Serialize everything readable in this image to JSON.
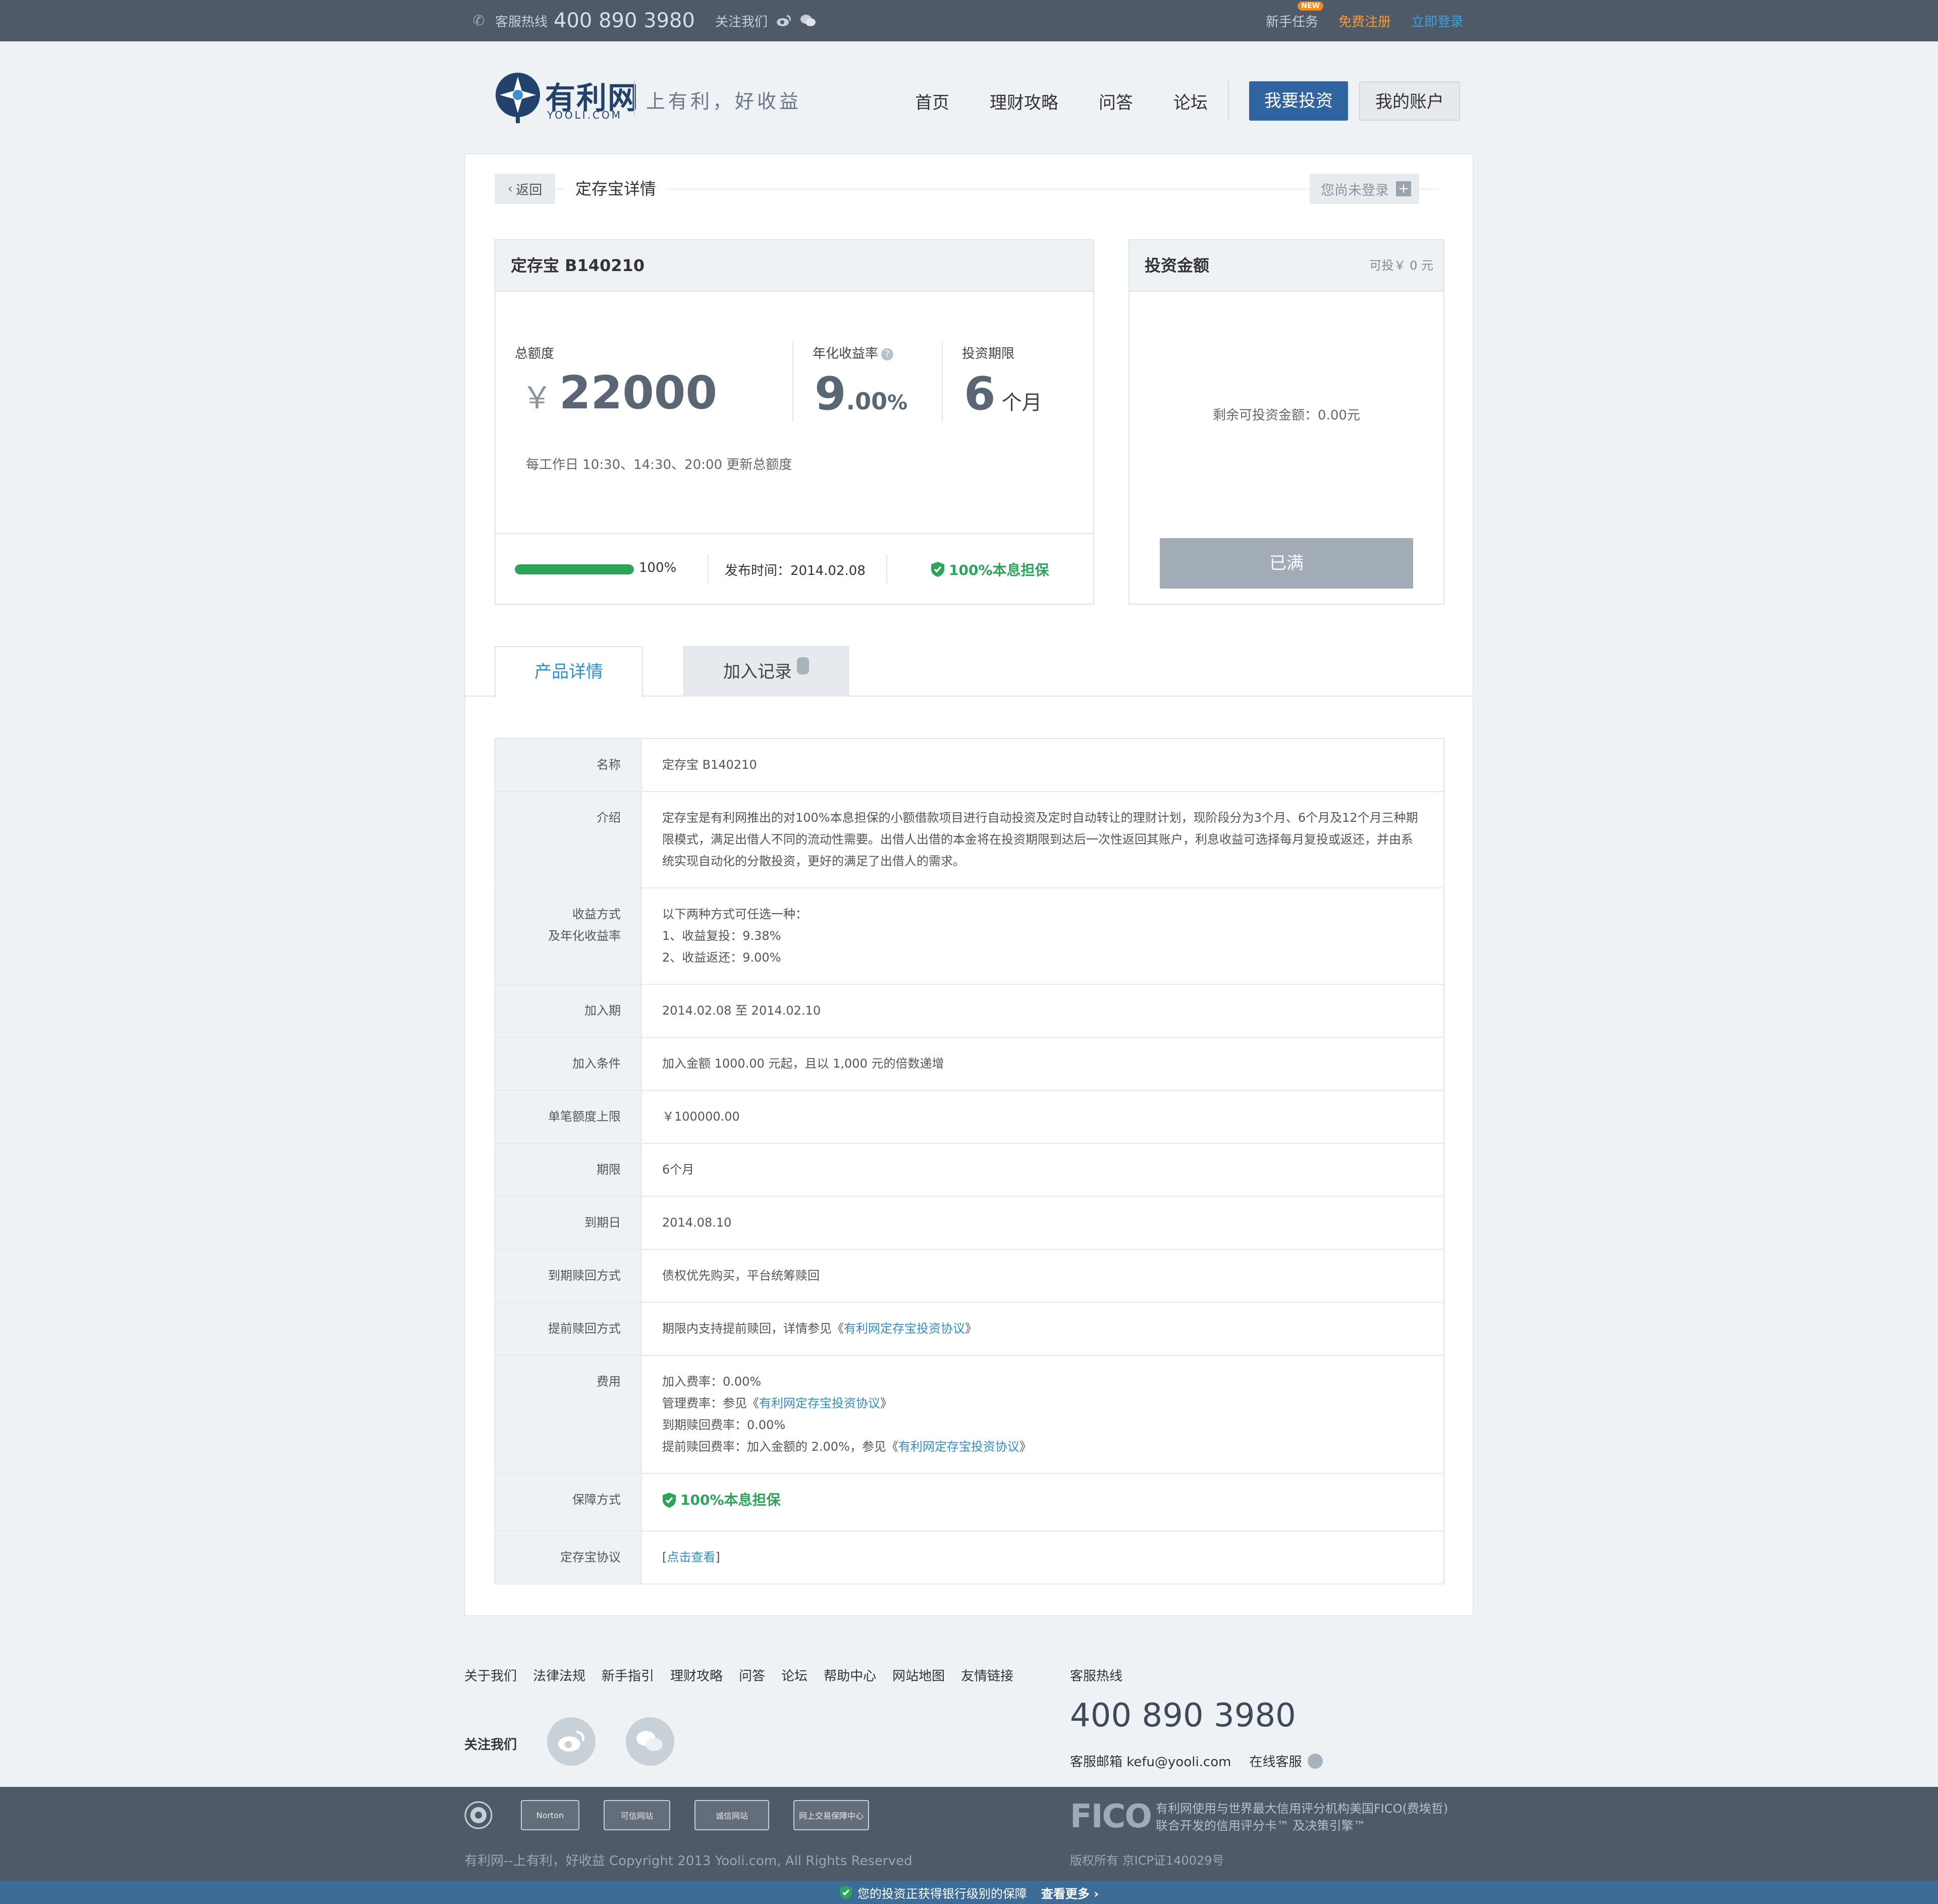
{
  "topbar": {
    "hotline_label": "客服热线",
    "hotline_number": "400 890 3980",
    "follow_label": "关注我们",
    "newbie_task": "新手任务",
    "new_badge": "NEW",
    "register": "免费注册",
    "login": "立即登录"
  },
  "header": {
    "logo_text": "有利网",
    "logo_sub": "YOOLI.COM",
    "slogan": "上有利，好收益",
    "nav": [
      "首页",
      "理财攻略",
      "问答",
      "论坛"
    ],
    "invest_button": "我要投资",
    "account_button": "我的账户"
  },
  "crumb": {
    "back": "返回",
    "title": "定存宝详情",
    "not_logged_in": "您尚未登录"
  },
  "product": {
    "name": "定存宝 B140210",
    "total_label": "总额度",
    "currency": "￥",
    "total_value": "22000",
    "rate_label": "年化收益率",
    "rate_int": "9",
    "rate_dec": ".00",
    "rate_pct": "%",
    "term_label": "投资期限",
    "term_value": "6",
    "term_unit": "个月",
    "update_note": "每工作日 10:30、14:30、20:00 更新总额度",
    "progress_percent": 100,
    "progress_text": "100%",
    "publish_date": "发布时间：2014.02.08",
    "guarantee": "100%本息担保"
  },
  "invest": {
    "title": "投资金额",
    "available": "可投￥ 0 元",
    "remaining": "剩余可投资金额：0.00元",
    "full_button": "已满"
  },
  "tabs": {
    "details": "产品详情",
    "records": "加入记录"
  },
  "details": {
    "name_k": "名称",
    "name_v": "定存宝 B140210",
    "intro_k": "介绍",
    "intro_v1": "定存宝是有利网推出的对100%本息担保的小额借款项目进行自动投资及定时自动转让的理财计划，现阶段分为3个月、6个月及12个月三种期",
    "intro_v2": "限模式，满足出借人不同的流动性需要。出借人出借的本金将在投资期限到达后一次性返回其账户，利息收益可选择每月复投或返还，并由系",
    "intro_v3": "统实现自动化的分散投资，更好的满足了出借人的需求。",
    "income_k1": "收益方式",
    "income_k2": "及年化收益率",
    "income_v1": "以下两种方式可任选一种：",
    "income_v2": "1、收益复投：9.38%",
    "income_v3": "2、收益返还：9.00%",
    "join_k": "加入期",
    "join_v": "2014.02.08 至 2014.02.10",
    "cond_k": "加入条件",
    "cond_v": "加入金额 1000.00 元起，且以 1,000 元的倍数递增",
    "limit_k": "单笔额度上限",
    "limit_v": "￥100000.00",
    "term_k": "期限",
    "term_v": "6个月",
    "due_k": "到期日",
    "due_v": "2014.08.10",
    "redeem_k": "到期赎回方式",
    "redeem_v": "债权优先购买，平台统筹赎回",
    "early_k": "提前赎回方式",
    "early_v": "期限内支持提前赎回，详情参见《",
    "early_link": "有利网定存宝投资协议",
    "close_q": "》",
    "fee_k": "费用",
    "fee_v1": "加入费率：0.00%",
    "fee_v2_pre": "管理费率：参见《",
    "fee_v3": "到期赎回费率：0.00%",
    "fee_v4_pre": "提前赎回费率：加入金额的 2.00%，参见《",
    "protect_k": "保障方式",
    "protect_v": "100%本息担保",
    "agree_k": "定存宝协议",
    "agree_open": "[",
    "agree_link": "点击查看",
    "agree_close": "]"
  },
  "footer": {
    "links": [
      "关于我们",
      "法律法规",
      "新手指引",
      "理财攻略",
      "问答",
      "论坛",
      "帮助中心",
      "网站地图",
      "友情链接"
    ],
    "follow": "关注我们",
    "hotline_label": "客服热线",
    "hotline_number": "400 890 3980",
    "email": "客服邮箱 kefu@yooli.com",
    "online": "在线客服",
    "badges": [
      "Norton",
      "可信网站",
      "诚信网站",
      "网上交易保障中心"
    ],
    "copyright": "有利网--上有利，好收益 Copyright 2013 Yooli.com, All Rights Reserved",
    "fico": "FICO",
    "fico_line1": "有利网使用与世界最大信用评分机构美国FICO(费埃哲)",
    "fico_line2": "联合开发的信用评分卡™ 及决策引擎™",
    "icp": "版权所有 京ICP证140029号",
    "secure_text": "您的投资正获得银行级别的保障",
    "secure_more": "查看更多"
  },
  "colors": {
    "topbar": "#4e5a68",
    "brand_blue": "#2f64a0",
    "green": "#2aa55a",
    "orange": "#f59a3a",
    "link": "#2f8fd0"
  },
  "icons": [
    "phone-icon",
    "weibo-icon",
    "wechat-icon",
    "shield-check-icon",
    "help-icon",
    "plus-icon",
    "chevron-left-icon",
    "chat-icon"
  ]
}
